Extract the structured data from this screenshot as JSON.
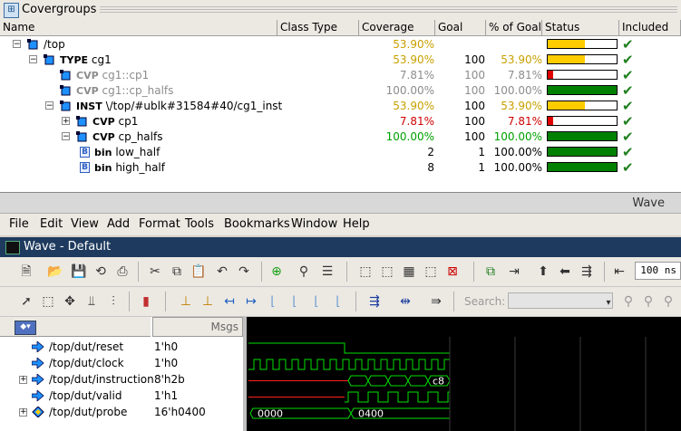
{
  "covergroups": {
    "title": "Covergroups",
    "columns": [
      "Name",
      "Class Type",
      "Coverage",
      "Goal",
      "% of Goal",
      "Status",
      "Included"
    ],
    "rows": [
      {
        "indent": 0,
        "toggle": "−",
        "kw": "",
        "name": "/top",
        "coverage": "53.90%",
        "goal": "",
        "pct": "",
        "status_fill": 0.539,
        "status_color": "#ffcc00",
        "cov_color": "gold",
        "text_color": "",
        "included": false
      },
      {
        "indent": 1,
        "toggle": "−",
        "kw": "TYPE",
        "name": "cg1",
        "coverage": "53.90%",
        "goal": "100",
        "pct": "53.90%",
        "status_fill": 0.539,
        "status_color": "#ffcc00",
        "cov_color": "gold",
        "text_color": "",
        "included": true
      },
      {
        "indent": 2,
        "toggle": "",
        "kw": "CVP",
        "name": "cg1::cp1",
        "coverage": "7.81%",
        "goal": "100",
        "pct": "7.81%",
        "status_fill": 0.078,
        "status_color": "#e00000",
        "cov_color": "",
        "text_color": "grey",
        "included": true
      },
      {
        "indent": 2,
        "toggle": "",
        "kw": "CVP",
        "name": "cg1::cp_halfs",
        "coverage": "100.00%",
        "goal": "100",
        "pct": "100.00%",
        "status_fill": 1.0,
        "status_color": "#008000",
        "cov_color": "",
        "text_color": "grey",
        "included": true
      },
      {
        "indent": 2,
        "toggle": "−",
        "kw": "INST",
        "name": "\\/top/#ublk#31584#40/cg1_inst",
        "coverage": "53.90%",
        "goal": "100",
        "pct": "53.90%",
        "status_fill": 0.539,
        "status_color": "#ffcc00",
        "cov_color": "gold",
        "text_color": "",
        "included": true
      },
      {
        "indent": 3,
        "toggle": "+",
        "kw": "CVP",
        "name": "cp1",
        "coverage": "7.81%",
        "goal": "100",
        "pct": "7.81%",
        "status_fill": 0.078,
        "status_color": "#e00000",
        "cov_color": "red",
        "text_color": "",
        "included": true
      },
      {
        "indent": 3,
        "toggle": "−",
        "kw": "CVP",
        "name": "cp_halfs",
        "coverage": "100.00%",
        "goal": "100",
        "pct": "100.00%",
        "status_fill": 1.0,
        "status_color": "#008000",
        "cov_color": "green",
        "text_color": "",
        "included": true
      },
      {
        "indent": 4,
        "toggle": "",
        "kw": "bin",
        "name": "low_half",
        "coverage": "2",
        "goal": "1",
        "pct": "100.00%",
        "status_fill": 1.0,
        "status_color": "#008000",
        "cov_color": "",
        "text_color": "",
        "included": true,
        "is_bin": true
      },
      {
        "indent": 4,
        "toggle": "",
        "kw": "bin",
        "name": "high_half",
        "coverage": "8",
        "goal": "1",
        "pct": "100.00%",
        "status_fill": 1.0,
        "status_color": "#008000",
        "cov_color": "",
        "text_color": "",
        "included": true,
        "is_bin": true
      }
    ]
  },
  "wave": {
    "window_title": "Wave",
    "menus": [
      "File",
      "Edit",
      "View",
      "Add",
      "Format",
      "Tools",
      "Bookmarks",
      "Window",
      "Help"
    ],
    "pane_title": "Wave - Default",
    "search_label": "Search:",
    "zoom_value": "100 ns",
    "msgs_header": "Msgs",
    "signals": [
      {
        "name": "/top/dut/reset",
        "value": "1'h0",
        "expandable": false
      },
      {
        "name": "/top/dut/clock",
        "value": "1'h0",
        "expandable": false
      },
      {
        "name": "/top/dut/instruction",
        "value": "8'h2b",
        "expandable": true
      },
      {
        "name": "/top/dut/valid",
        "value": "1'h1",
        "expandable": false
      },
      {
        "name": "/top/dut/probe",
        "value": "16'h0400",
        "expandable": true
      }
    ],
    "bus_labels": {
      "instruction_last": "c8",
      "probe_first": "0000",
      "probe_second": "0400"
    }
  }
}
